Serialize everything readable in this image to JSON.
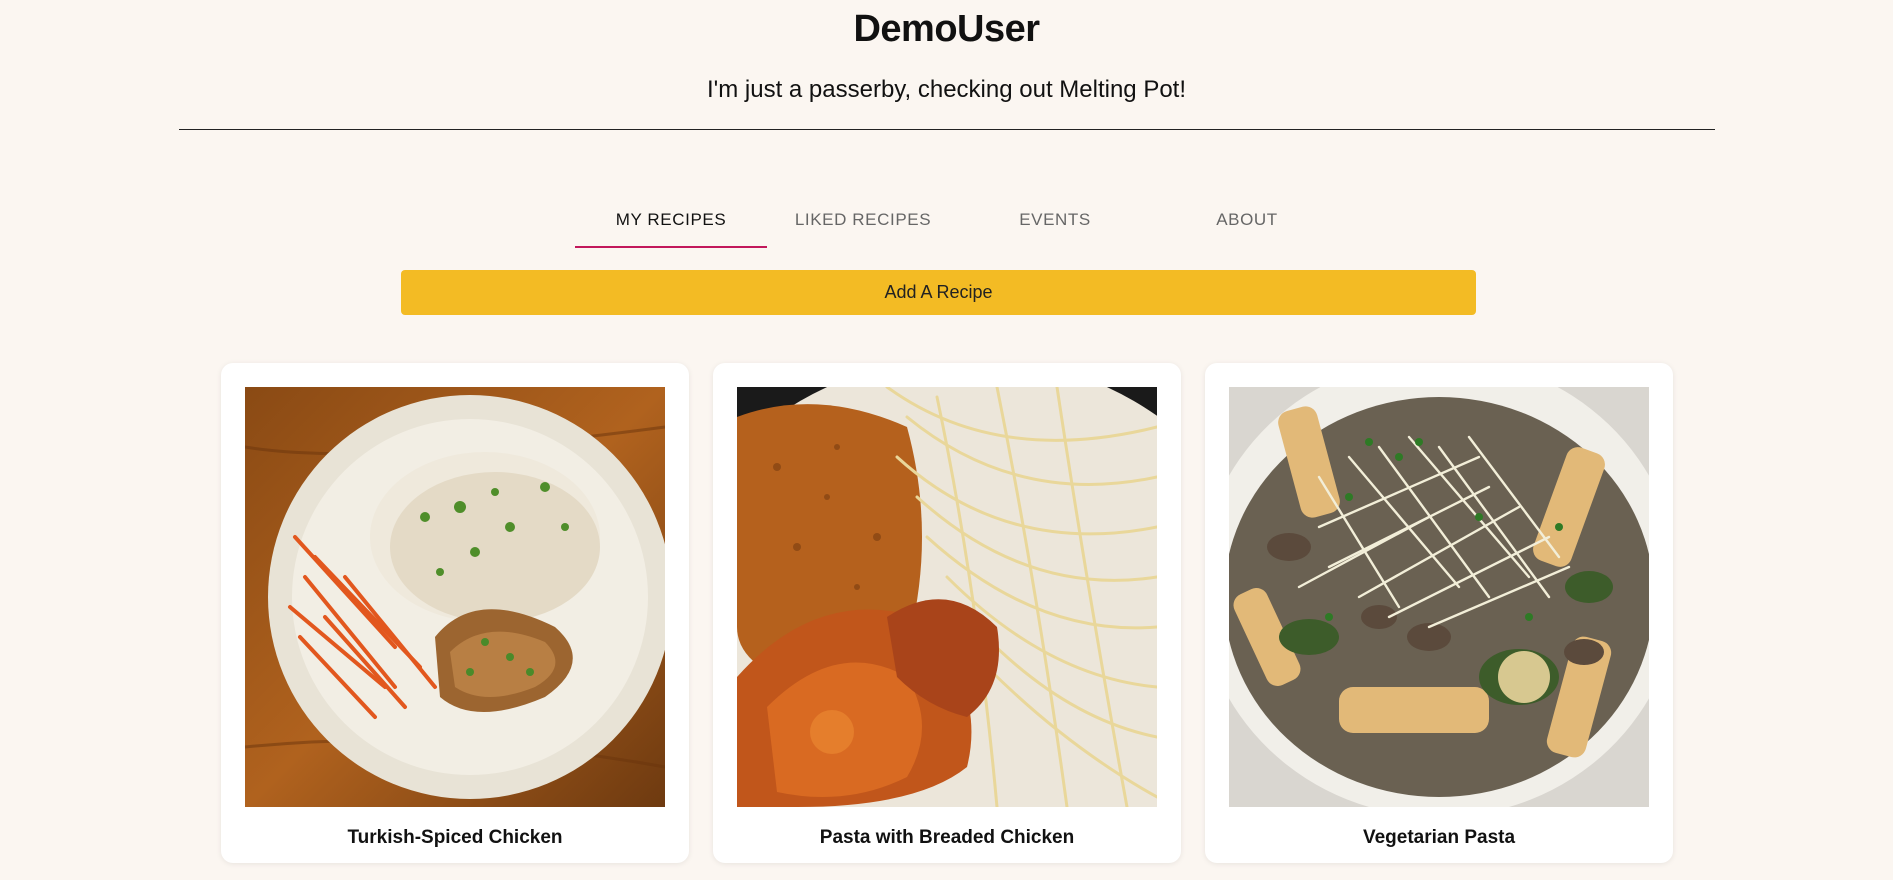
{
  "profile": {
    "name": "DemoUser",
    "bio": "I'm just a passerby, checking out Melting Pot!"
  },
  "tabs": [
    {
      "label": "MY RECIPES",
      "active": true
    },
    {
      "label": "LIKED RECIPES",
      "active": false
    },
    {
      "label": "EVENTS",
      "active": false
    },
    {
      "label": "ABOUT",
      "active": false
    }
  ],
  "add_recipe_label": "Add A Recipe",
  "recipes": [
    {
      "title": "Turkish-Spiced Chicken"
    },
    {
      "title": "Pasta with Breaded Chicken"
    },
    {
      "title": "Vegetarian Pasta"
    }
  ],
  "colors": {
    "background": "#fbf6f1",
    "accent_button": "#f3bb24",
    "active_tab_underline": "#c2185b"
  }
}
